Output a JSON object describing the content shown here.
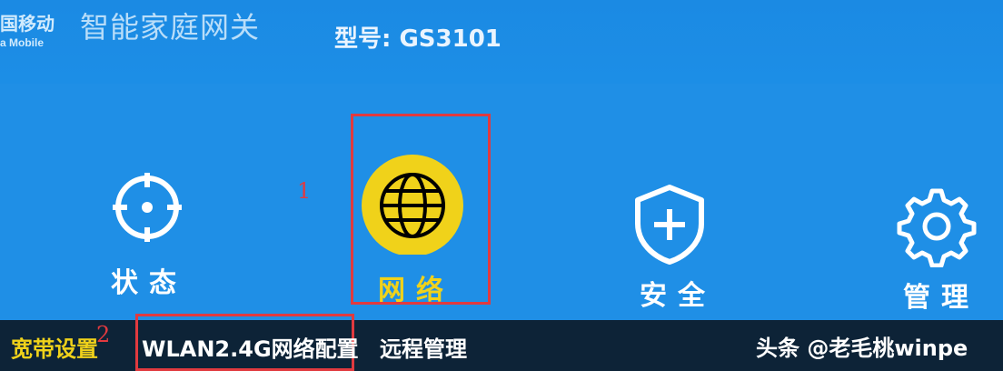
{
  "header": {
    "brand_cn": "国移动",
    "brand_en": "a Mobile",
    "title": "智能家庭网关",
    "model": "型号: GS3101"
  },
  "nav": {
    "status_label": "状态",
    "network_label": "网络",
    "security_label": "安全",
    "manage_label": "管理",
    "icons": [
      "crosshair-icon",
      "globe-icon",
      "shield-plus-icon",
      "gear-icon"
    ]
  },
  "annotations": {
    "marker_1": "1",
    "marker_2": "2"
  },
  "bottom_tabs": {
    "tab1": "宽带设置",
    "tab2": "WLAN2.4G网络配置",
    "tab3": "远程管理"
  },
  "watermark": {
    "text": "头条 @老毛桃winpe"
  },
  "colors": {
    "background": "#1f8fe6",
    "highlight_red": "#e13a3f",
    "active_yellow": "#f0d21a",
    "bottom_bar": "#0d2337",
    "active_text": "#f0d21a"
  }
}
